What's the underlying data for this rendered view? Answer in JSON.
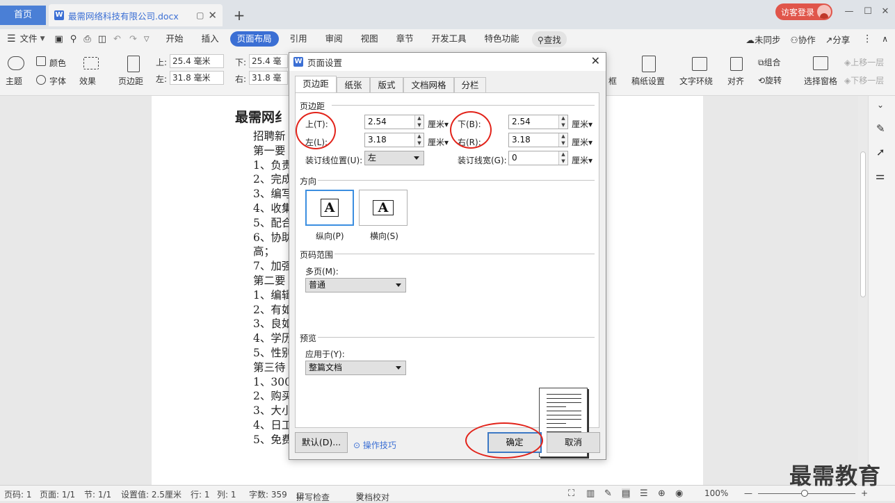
{
  "tabs": {
    "home": "首页",
    "document": "最需网络科技有限公司.docx",
    "new_tab": "+"
  },
  "visitor_login": "访客登录",
  "menu": {
    "file": "文件",
    "items": [
      "开始",
      "插入",
      "页面布局",
      "引用",
      "审阅",
      "视图",
      "章节",
      "开发工具",
      "特色功能"
    ],
    "search": "查找",
    "right": [
      "未同步",
      "协作",
      "分享"
    ]
  },
  "toolbar": {
    "theme": "主题",
    "color": "颜色",
    "font": "字体",
    "effect": "效果",
    "margins": "页边距",
    "top_label": "上:",
    "top_value": "25.4 毫米",
    "bottom_label": "下:",
    "bottom_value": "25.4 毫米",
    "left_label": "左:",
    "left_value": "31.8 毫米",
    "right_label": "右:",
    "right_value": "31.8 毫米",
    "frame_partial": "框",
    "manuscript": "稿纸设置",
    "wrap": "文字环绕",
    "align": "对齐",
    "group": "组合",
    "rotate": "旋转",
    "selection": "选择窗格",
    "up": "上移一层",
    "down": "下移一层"
  },
  "document": {
    "heading": "最需网纟",
    "lines": [
      "招聘新",
      "第一要",
      "1、负责",
      "2、完成",
      "3、编写",
      "4、收集",
      "5、配合",
      "6、协助",
      "高；",
      "7、加强",
      "第二要",
      "1、编辑",
      "2、有如",
      "3、良如",
      "4、学历",
      "5、性别",
      "第三待",
      "1、300",
      "2、购买",
      "3、大小",
      "4、日工",
      "5、免费"
    ]
  },
  "dialog": {
    "title": "页面设置",
    "tabs": [
      "页边距",
      "纸张",
      "版式",
      "文档网格",
      "分栏"
    ],
    "margins_section": "页边距",
    "top_label": "上(T):",
    "top_value": "2.54",
    "bottom_label": "下(B):",
    "bottom_value": "2.54",
    "left_label": "左(L):",
    "left_value": "3.18",
    "right_label": "右(R):",
    "right_value": "3.18",
    "unit": "厘米",
    "gutter_pos_label": "装订线位置(U):",
    "gutter_pos_value": "左",
    "gutter_width_label": "装订线宽(G):",
    "gutter_width_value": "0",
    "orientation_section": "方向",
    "portrait": "纵向(P)",
    "landscape": "横向(S)",
    "orient_glyph": "A",
    "page_range_section": "页码范围",
    "multi_page_label": "多页(M):",
    "multi_page_value": "普通",
    "preview_section": "预览",
    "apply_label": "应用于(Y):",
    "apply_value": "整篇文档",
    "default_button": "默认(D)...",
    "tips_link": "操作技巧",
    "ok_button": "确定",
    "cancel_button": "取消"
  },
  "status": {
    "page_no": "页码: 1",
    "pages": "页面: 1/1",
    "section": "节: 1/1",
    "setting": "设置值: 2.5厘米",
    "row": "行: 1",
    "col": "列: 1",
    "words": "字数: 359",
    "spell": "拼写检查",
    "proof": "文档校对",
    "zoom": "100%"
  },
  "watermark": "最需教育",
  "colors": {
    "accent": "#3b6fd4",
    "annotation": "#e2231a",
    "visitor": "#e0554a"
  }
}
